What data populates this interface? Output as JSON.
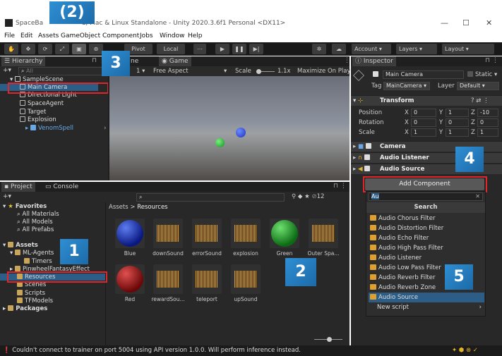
{
  "window": {
    "title": "SpaceBa... C, Mac & Linux Standalone - Unity 2020.3.6f1 Personal <DX11>",
    "title_left": "SpaceBa",
    "title_right": "C, Mac & Linux Standalone - Unity 2020.3.6f1 Personal <DX11>"
  },
  "menu": [
    "File",
    "Edit",
    "Assets",
    "GameObject",
    "Component",
    "Jobs",
    "Window",
    "Help"
  ],
  "toolbar": {
    "pivot": "Pivot",
    "local": "Local",
    "account": "Account",
    "layers": "Layers",
    "layout": "Layout"
  },
  "hierarchy": {
    "title": "Hierarchy",
    "search_placeholder": "All",
    "scene": "SampleScene",
    "items": [
      "Main Camera",
      "Directional Light",
      "SpaceAgent",
      "Target",
      "Explosion",
      "VenomSpell"
    ]
  },
  "scene_view": {
    "tab_scene": "ne",
    "tab_game": "Game",
    "display": "1",
    "aspect": "Free Aspect",
    "scale_label": "Scale",
    "scale_value": "1.1x",
    "maximize": "Maximize On Play"
  },
  "project": {
    "tab_project": "Project",
    "tab_console": "Console",
    "count": "12",
    "breadcrumb_root": "Assets",
    "breadcrumb_current": "Resources",
    "tree": {
      "favorites": "Favorites",
      "fav_items": [
        "All Materials",
        "All Models",
        "All Prefabs"
      ],
      "assets": "Assets",
      "ml_agents": "ML-Agents",
      "timers": "Timers",
      "pinwheel": "PinwheelFantasyEffect",
      "resources": "Resources",
      "scenes": "Scenes",
      "scripts": "Scripts",
      "tfmodels": "TFModels",
      "packages": "Packages"
    },
    "assets_row1": [
      "Blue",
      "downSound",
      "errorSound",
      "explosion",
      "Green",
      "Outer Spa..."
    ],
    "assets_row2": [
      "Red",
      "rewardSou...",
      "teleport",
      "upSound"
    ]
  },
  "inspector": {
    "title": "Inspector",
    "name": "Main Camera",
    "static": "Static",
    "tag_label": "Tag",
    "tag_value": "MainCamera",
    "layer_label": "Layer",
    "layer_value": "Default",
    "transform": {
      "title": "Transform",
      "rows": [
        {
          "label": "Position",
          "x": "0",
          "y": "1",
          "z": "-10"
        },
        {
          "label": "Rotation",
          "x": "0",
          "y": "0",
          "z": "0"
        },
        {
          "label": "Scale",
          "x": "1",
          "y": "1",
          "z": "1"
        }
      ]
    },
    "components": [
      "Camera",
      "Audio Listener",
      "Audio Source"
    ],
    "add_component": "Add Component",
    "search_value": "Au",
    "search_header": "Search",
    "results": [
      "Audio Chorus Filter",
      "Audio Distortion Filter",
      "Audio Echo Filter",
      "Audio High Pass Filter",
      "Audio Listener",
      "Audio Low Pass Filter",
      "Audio Reverb Filter",
      "Audio Reverb Zone",
      "Audio Source"
    ],
    "new_script": "New script"
  },
  "status": {
    "message": "Couldn't connect to trainer on port 5004 using API version 1.0.0. Will perform inference instead."
  },
  "annotations": {
    "step2_top": "(2)",
    "n1": "1",
    "n2": "2",
    "n3": "3",
    "n4": "4",
    "n5": "5"
  },
  "colors": {
    "annotation_red": "#e0262a",
    "badge_blue": "#2f8fd4",
    "selection": "#2c5d87",
    "accent_orange": "#e39a24"
  }
}
